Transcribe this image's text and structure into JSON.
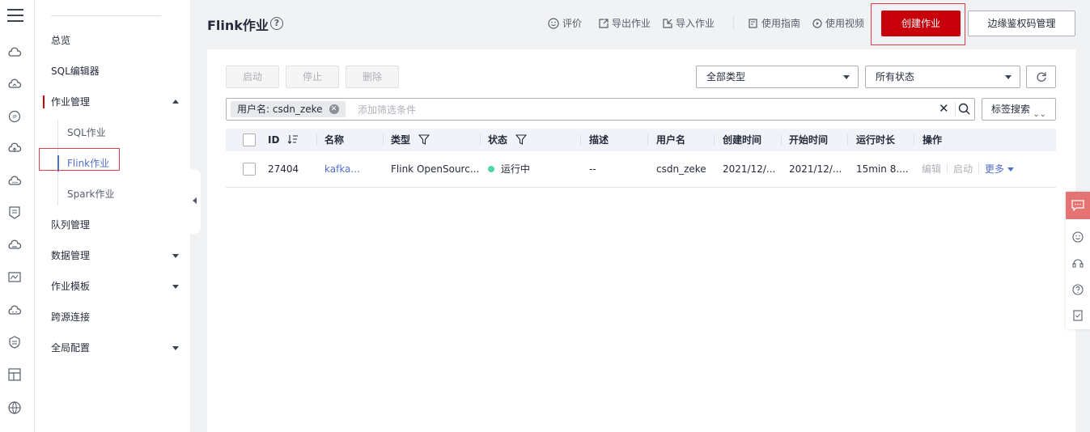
{
  "header": {
    "title": "Flink作业",
    "tools": {
      "rate": "评价",
      "export": "导出作业",
      "import": "导入作业",
      "guide": "使用指南",
      "video": "使用视频"
    },
    "create_button": "创建作业",
    "auth_button": "边缘鉴权码管理"
  },
  "nav": {
    "items": [
      {
        "label": "总览"
      },
      {
        "label": "SQL编辑器"
      },
      {
        "label": "作业管理"
      },
      {
        "label": "SQL作业"
      },
      {
        "label": "Flink作业"
      },
      {
        "label": "Spark作业"
      },
      {
        "label": "队列管理"
      },
      {
        "label": "数据管理"
      },
      {
        "label": "作业模板"
      },
      {
        "label": "跨源连接"
      },
      {
        "label": "全局配置"
      }
    ]
  },
  "toolbar": {
    "start": "启动",
    "stop": "停止",
    "delete": "删除",
    "type_select": "全部类型",
    "status_select": "所有状态"
  },
  "filter": {
    "chip": "用户名: csdn_zeke",
    "placeholder": "添加筛选条件",
    "tag_search": "标签搜索"
  },
  "table": {
    "columns": [
      "ID",
      "名称",
      "类型",
      "状态",
      "描述",
      "用户名",
      "创建时间",
      "开始时间",
      "运行时长",
      "操作"
    ],
    "rows": [
      {
        "id": "27404",
        "name": "kafka...",
        "type": "Flink OpenSourc...",
        "status": "运行中",
        "desc": "--",
        "user": "csdn_zeke",
        "created": "2021/12/...",
        "started": "2021/12/...",
        "duration": "15min 8....",
        "ops": {
          "edit": "编辑",
          "start": "启动",
          "more": "更多"
        }
      }
    ]
  },
  "colors": {
    "brand": "#c7000b",
    "link": "#526ecc",
    "running": "#50d4ab"
  }
}
